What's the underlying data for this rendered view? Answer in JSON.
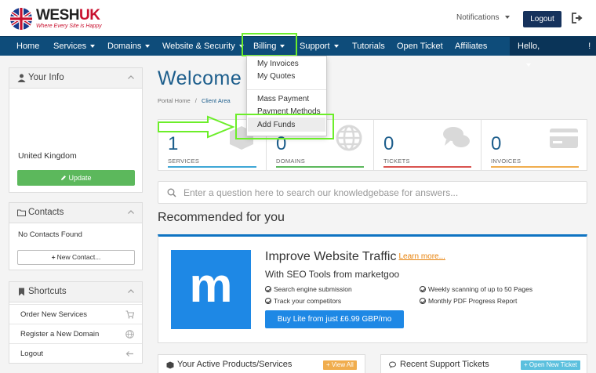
{
  "header": {
    "logo_text_main": "WESH",
    "logo_text_accent": "UK",
    "logo_tagline": "Where Every Site is Happy",
    "notifications_label": "Notifications",
    "logout_label": "Logout"
  },
  "nav": {
    "items": [
      {
        "label": "Home"
      },
      {
        "label": "Services"
      },
      {
        "label": "Domains"
      },
      {
        "label": "Website & Security"
      },
      {
        "label": "Billing"
      },
      {
        "label": "Support"
      },
      {
        "label": "Tutorials"
      },
      {
        "label": "Open Ticket"
      },
      {
        "label": "Affiliates"
      }
    ],
    "hello_label": "Hello,",
    "hello_bang": "!"
  },
  "billing_menu": {
    "items": [
      "My Invoices",
      "My Quotes",
      "Mass Payment",
      "Payment Methods",
      "Add Funds"
    ],
    "selected": "Add Funds"
  },
  "sidebar": {
    "your_info": {
      "title": "Your Info",
      "country": "United Kingdom",
      "update_label": "Update"
    },
    "contacts": {
      "title": "Contacts",
      "empty_text": "No Contacts Found",
      "new_label": "New Contact..."
    },
    "shortcuts": {
      "title": "Shortcuts",
      "items": [
        "Order New Services",
        "Register a New Domain",
        "Logout"
      ]
    }
  },
  "main": {
    "welcome": "Welcome",
    "breadcrumb": {
      "home": "Portal Home",
      "sep": "/",
      "current": "Client Area"
    },
    "stats": [
      {
        "value": "1",
        "label": "SERVICES",
        "color": "#3fa7d6"
      },
      {
        "value": "0",
        "label": "DOMAINS",
        "color": "#5cb85c"
      },
      {
        "value": "0",
        "label": "TICKETS",
        "color": "#d9534f"
      },
      {
        "value": "0",
        "label": "INVOICES",
        "color": "#f0ad4e"
      }
    ],
    "kb_placeholder": "Enter a question here to search our knowledgebase for answers...",
    "recommended_title": "Recommended for you",
    "promo": {
      "logo_letter": "m",
      "title": "Improve Website Traffic",
      "learn_more": "Learn more...",
      "subtitle": "With SEO Tools from marketgoo",
      "features": [
        "Search engine submission",
        "Track your competitors",
        "Weekly scanning of up to 50 Pages",
        "Monthly PDF Progress Report"
      ],
      "buy_label": "Buy Lite from just £6.99 GBP/mo"
    },
    "active_products": {
      "title": "Your Active Products/Services",
      "button": "View All"
    },
    "support_tickets": {
      "title": "Recent Support Tickets",
      "button": "Open New Ticket"
    }
  },
  "colors": {
    "nav": "#0e4c7a",
    "accent": "#1d5e8c",
    "highlight": "#6cee2a",
    "green": "#5cb85c",
    "orange": "#f0ad4e",
    "brand_blue": "#1e88e5"
  }
}
